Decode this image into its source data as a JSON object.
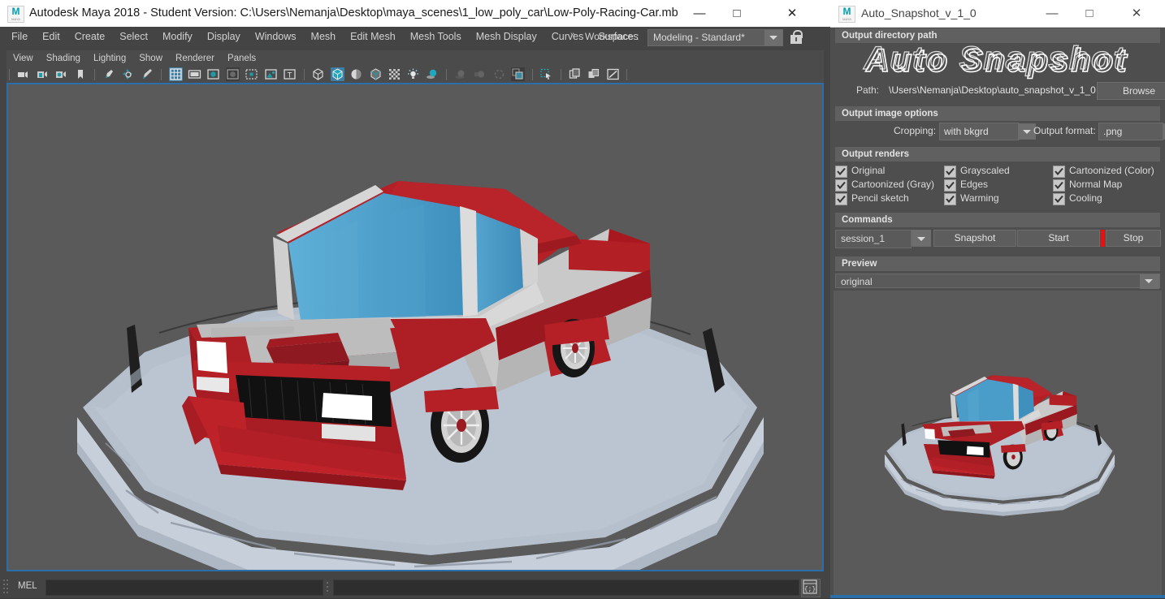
{
  "maya": {
    "title": "Autodesk Maya 2018 - Student Version: C:\\Users\\Nemanja\\Desktop\\maya_scenes\\1_low_poly_car\\Low-Poly-Racing-Car.mb",
    "logo_letter": "M",
    "logo_sub": "MAYA",
    "window_controls": {
      "minimize": "—",
      "maximize": "□",
      "close": "✕"
    },
    "menus": [
      "File",
      "Edit",
      "Create",
      "Select",
      "Modify",
      "Display",
      "Windows",
      "Mesh",
      "Edit Mesh",
      "Mesh Tools",
      "Mesh Display",
      "Curves",
      "Surfaces"
    ],
    "workspace": {
      "chevron": "»",
      "label": "Workspace :",
      "selected": "Modeling - Standard*",
      "lock_icon": "lock-icon"
    },
    "panel_menus": [
      "View",
      "Shading",
      "Lighting",
      "Show",
      "Renderer",
      "Panels"
    ],
    "toolbar_icons": [
      "camera-icon",
      "camera-lock-icon",
      "camera-attributes-icon",
      "bookmark-icon",
      "grease-pencil-icon",
      "2d-pan-zoom-icon",
      "pencil-icon",
      "grid-icon",
      "film-gate-icon",
      "resolution-gate-icon",
      "gate-mask-icon",
      "film-origin-icon",
      "image-plane-icon",
      "hud-text-icon",
      "wireframe-icon",
      "smooth-shade-icon",
      "shade-x-ray-icon",
      "smooth-wireframe-icon",
      "textured-icon",
      "lighting-icon",
      "shadows-icon",
      "screen-space-ao-icon",
      "motion-blur-icon",
      "multisample-icon",
      "depth-peel-icon",
      "isolate-select-icon",
      "xray-joints-icon",
      "xray-active-icon",
      "exposure-icon"
    ],
    "mel": {
      "label": "MEL",
      "command_value": "",
      "result_value": "",
      "script_editor_icon": "script-editor-icon"
    }
  },
  "snapshot": {
    "title": "Auto_Snapshot_v_1_0",
    "logo_letter": "M",
    "logo_sub": "MAYA",
    "window_controls": {
      "minimize": "—",
      "maximize": "□",
      "close": "✕"
    },
    "logo_text": "Auto Snapshot",
    "groups": {
      "output_directory": "Output directory path",
      "output_image_options": "Output image options",
      "output_renders": "Output renders",
      "commands": "Commands",
      "preview": "Preview"
    },
    "path": {
      "label": "Path:",
      "value": "\\Users\\Nemanja\\Desktop\\auto_snapshot_v_1_0",
      "browse_label": "Browse"
    },
    "image_options": {
      "cropping_label": "Cropping:",
      "cropping_value": "with bkgrd",
      "format_label": "Output format:",
      "format_value": ".png"
    },
    "renders": [
      {
        "label": "Original",
        "checked": true
      },
      {
        "label": "Grayscaled",
        "checked": true
      },
      {
        "label": "Cartoonized (Color)",
        "checked": true
      },
      {
        "label": "Cartoonized (Gray)",
        "checked": true
      },
      {
        "label": "Edges",
        "checked": true
      },
      {
        "label": "Normal Map",
        "checked": true
      },
      {
        "label": "Pencil sketch",
        "checked": true
      },
      {
        "label": "Warming",
        "checked": true
      },
      {
        "label": "Cooling",
        "checked": true
      }
    ],
    "commands": {
      "session_value": "session_1",
      "snapshot_label": "Snapshot",
      "start_label": "Start",
      "stop_label": "Stop",
      "divider_color": "#e81010"
    },
    "preview_selected": "original"
  },
  "colors": {
    "accent_blue": "#2b6ea8",
    "panel_bg": "#4e4e4e",
    "viewport_bg": "#5a5a5a",
    "car_red": "#b02025",
    "car_glass": "#4a9cc9",
    "platform_light": "#c3ccd6",
    "stop_divider": "#e81010"
  },
  "scene": {
    "name": "Low-Poly-Racing-Car",
    "objects": [
      "low-poly car",
      "display platform"
    ]
  }
}
